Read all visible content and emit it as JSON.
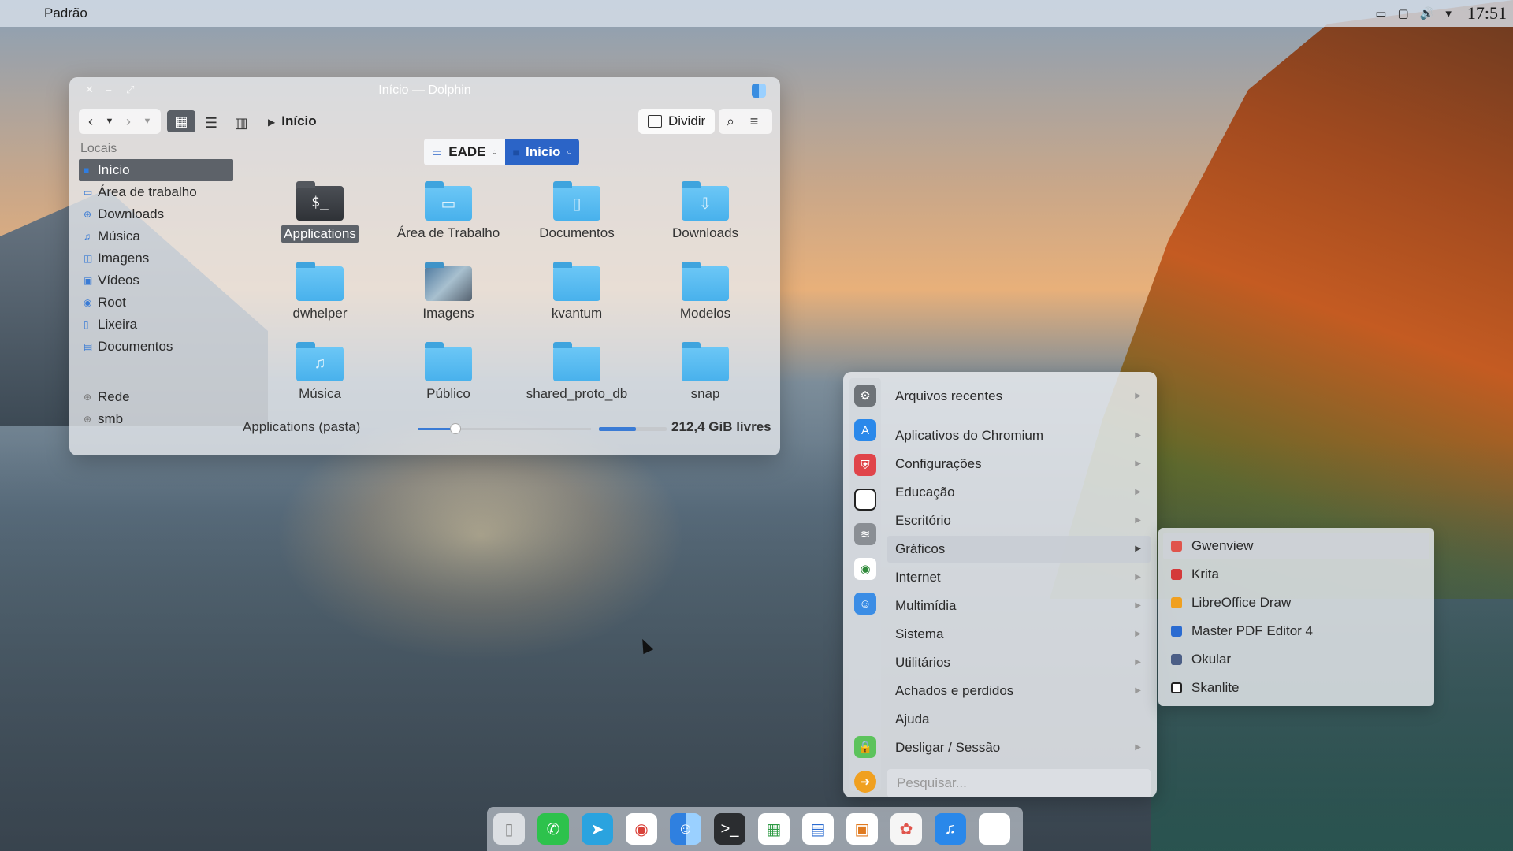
{
  "topbar": {
    "app_name": "Padrão",
    "clock": "17:51",
    "tray_icons": [
      "battery-icon",
      "display-icon",
      "volume-icon",
      "chevron-down-icon"
    ]
  },
  "window": {
    "title": "Início — Dolphin",
    "breadcrumb": "Início",
    "split_label": "Dividir",
    "sidebar": {
      "places_header": "Locais",
      "places": [
        {
          "label": "Início",
          "icon": "home-icon",
          "selected": true
        },
        {
          "label": "Área de trabalho",
          "icon": "desktop-icon"
        },
        {
          "label": "Downloads",
          "icon": "download-icon"
        },
        {
          "label": "Música",
          "icon": "music-icon"
        },
        {
          "label": "Imagens",
          "icon": "image-icon"
        },
        {
          "label": "Vídeos",
          "icon": "video-icon"
        },
        {
          "label": "Root",
          "icon": "root-icon"
        },
        {
          "label": "Lixeira",
          "icon": "trash-icon"
        },
        {
          "label": "Documentos",
          "icon": "document-icon"
        }
      ],
      "network": [
        {
          "label": "Rede",
          "icon": "network-icon"
        },
        {
          "label": "smb",
          "icon": "network-icon"
        }
      ]
    },
    "tabs": [
      {
        "label": "EADE"
      },
      {
        "label": "Início"
      }
    ],
    "files": [
      {
        "name": "Applications",
        "icon": "terminal-folder-icon",
        "selected": true
      },
      {
        "name": "Área de Trabalho",
        "icon": "desktop-folder-icon"
      },
      {
        "name": "Documentos",
        "icon": "documents-folder-icon"
      },
      {
        "name": "Downloads",
        "icon": "downloads-folder-icon"
      },
      {
        "name": "dwhelper",
        "icon": "folder-icon"
      },
      {
        "name": "Imagens",
        "icon": "pictures-folder-icon"
      },
      {
        "name": "kvantum",
        "icon": "folder-icon"
      },
      {
        "name": "Modelos",
        "icon": "folder-icon"
      },
      {
        "name": "Música",
        "icon": "music-folder-icon"
      },
      {
        "name": "Público",
        "icon": "folder-icon"
      },
      {
        "name": "shared_proto_db",
        "icon": "folder-icon"
      },
      {
        "name": "snap",
        "icon": "folder-icon"
      }
    ],
    "status": {
      "text": "Applications (pasta)",
      "zoom_level": 0.22,
      "free_space_fraction": 0.55,
      "free_space": "212,4 GiB livres"
    }
  },
  "app_menu": {
    "items": [
      {
        "label": "Arquivos recentes",
        "submenu": true
      },
      {
        "label": "Aplicativos do Chromium",
        "submenu": true
      },
      {
        "label": "Configurações",
        "submenu": true
      },
      {
        "label": "Educação",
        "submenu": true
      },
      {
        "label": "Escritório",
        "submenu": true
      },
      {
        "label": "Gráficos",
        "submenu": true,
        "active": true
      },
      {
        "label": "Internet",
        "submenu": true
      },
      {
        "label": "Multimídia",
        "submenu": true
      },
      {
        "label": "Sistema",
        "submenu": true
      },
      {
        "label": "Utilitários",
        "submenu": true
      },
      {
        "label": "Achados e perdidos",
        "submenu": true
      },
      {
        "label": "Ajuda",
        "submenu": false
      },
      {
        "label": "Desligar / Sessão",
        "submenu": true
      }
    ],
    "search_placeholder": "Pesquisar...",
    "side_icons": [
      "settings-icon",
      "app-store-icon",
      "shield-icon",
      "blank-app-icon",
      "waveform-icon",
      "chrome-icon",
      "finder-icon",
      "lock-icon",
      "arrow-right-icon"
    ],
    "submenu_items": [
      {
        "label": "Gwenview",
        "color": "#e0544c"
      },
      {
        "label": "Krita",
        "color": "#d43a3a"
      },
      {
        "label": "LibreOffice Draw",
        "color": "#f0a020"
      },
      {
        "label": "Master PDF Editor 4",
        "color": "#2a6bd1"
      },
      {
        "label": "Okular",
        "color": "#4b5e86"
      },
      {
        "label": "Skanlite",
        "color": "#ffffff"
      }
    ]
  },
  "dock": {
    "apps": [
      "trash-icon",
      "whatsapp-icon",
      "telegram-icon",
      "chrome-icon",
      "finder-icon",
      "terminal-icon",
      "spreadsheet-icon",
      "writer-icon",
      "presentation-icon",
      "photos-icon",
      "music-icon",
      "apple-icon"
    ]
  },
  "colors": {
    "accent": "#2b64c7",
    "folder": "#48b1ec",
    "selection": "#5d6269"
  }
}
